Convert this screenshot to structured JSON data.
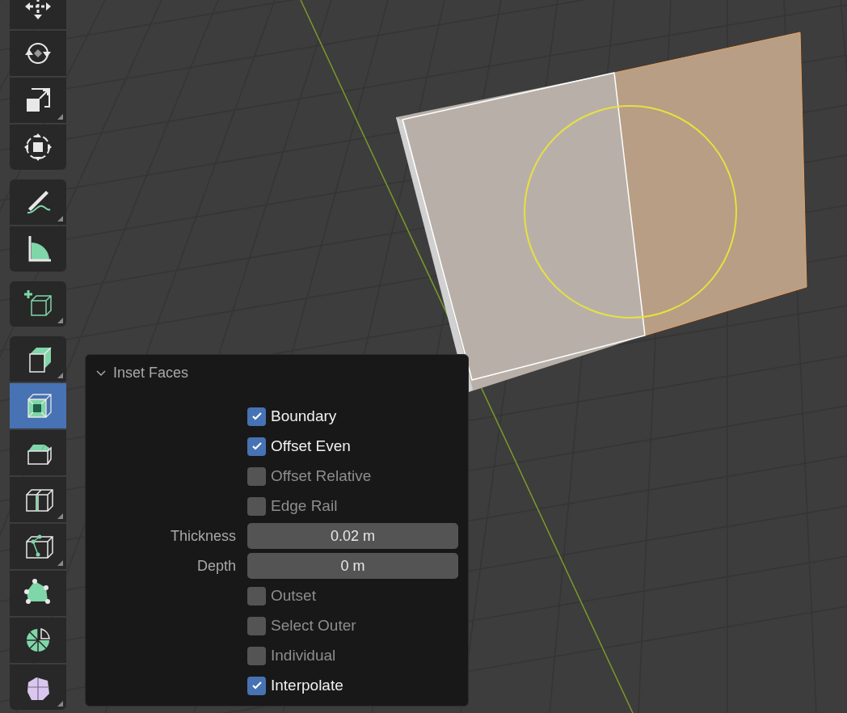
{
  "toolbar": {
    "groups": [
      {
        "tools": [
          {
            "kind": "move",
            "selected": false,
            "has_menu": false
          },
          {
            "kind": "rotate",
            "selected": false,
            "has_menu": false
          },
          {
            "kind": "scale",
            "selected": false,
            "has_menu": true
          },
          {
            "kind": "transform",
            "selected": false,
            "has_menu": false
          }
        ]
      },
      {
        "tools": [
          {
            "kind": "annotate",
            "selected": false,
            "has_menu": true
          },
          {
            "kind": "measure",
            "selected": false,
            "has_menu": false
          }
        ]
      },
      {
        "tools": [
          {
            "kind": "add_cube",
            "selected": false,
            "has_menu": true
          }
        ]
      },
      {
        "tools": [
          {
            "kind": "extrude",
            "selected": false,
            "has_menu": true
          },
          {
            "kind": "inset",
            "selected": true,
            "has_menu": false
          },
          {
            "kind": "bevel",
            "selected": false,
            "has_menu": false
          },
          {
            "kind": "loop_cut",
            "selected": false,
            "has_menu": true
          },
          {
            "kind": "knife",
            "selected": false,
            "has_menu": true
          },
          {
            "kind": "poly_build",
            "selected": false,
            "has_menu": false
          },
          {
            "kind": "spin",
            "selected": false,
            "has_menu": false
          },
          {
            "kind": "smooth",
            "selected": false,
            "has_menu": true
          }
        ]
      }
    ]
  },
  "operator_panel": {
    "title": "Inset Faces",
    "expanded": true,
    "rows": [
      {
        "kind": "checkbox",
        "label": "Boundary",
        "checked": true
      },
      {
        "kind": "checkbox",
        "label": "Offset Even",
        "checked": true
      },
      {
        "kind": "checkbox",
        "label": "Offset Relative",
        "checked": false
      },
      {
        "kind": "checkbox",
        "label": "Edge Rail",
        "checked": false
      },
      {
        "kind": "number",
        "label": "Thickness",
        "value": "0.02 m"
      },
      {
        "kind": "number",
        "label": "Depth",
        "value": "0 m"
      },
      {
        "kind": "checkbox",
        "label": "Outset",
        "checked": false
      },
      {
        "kind": "checkbox",
        "label": "Select Outer",
        "checked": false
      },
      {
        "kind": "checkbox",
        "label": "Individual",
        "checked": false
      },
      {
        "kind": "checkbox",
        "label": "Interpolate",
        "checked": true
      }
    ]
  }
}
